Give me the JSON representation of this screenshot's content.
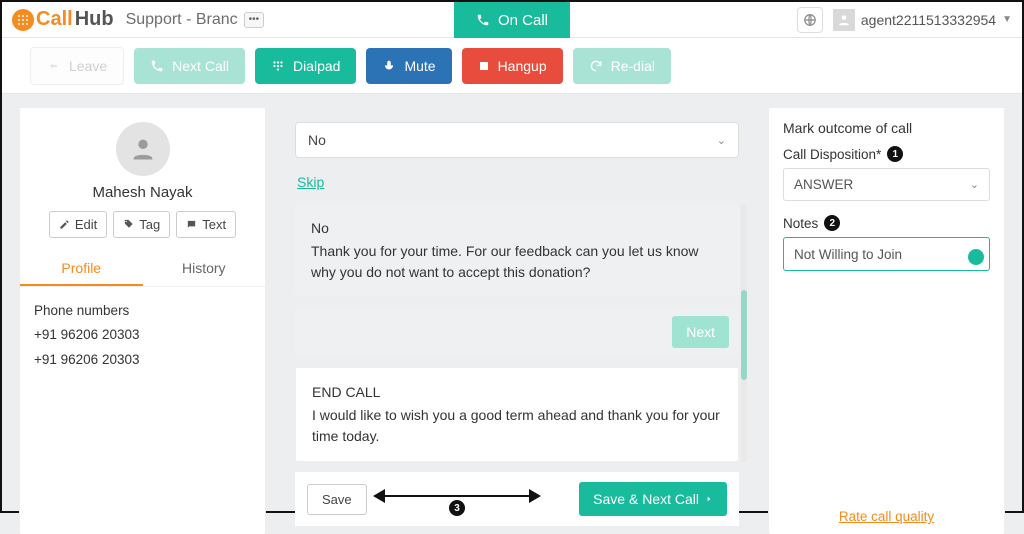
{
  "header": {
    "logo_call": "Call",
    "logo_hub": "Hub",
    "page_title": "Support - Branc",
    "on_call": "On Call",
    "agent_name": "agent2211513332954"
  },
  "toolbar": {
    "leave": "Leave",
    "next_call": "Next Call",
    "dialpad": "Dialpad",
    "mute": "Mute",
    "hangup": "Hangup",
    "redial": "Re-dial"
  },
  "contact": {
    "name": "Mahesh Nayak",
    "edit": "Edit",
    "tag": "Tag",
    "text": "Text",
    "tab_profile": "Profile",
    "tab_history": "History",
    "phone_label": "Phone numbers",
    "phone1": "+91 96206 20303",
    "phone2": "+91 96206 20303"
  },
  "script": {
    "answer_value": "No",
    "skip": "Skip",
    "block1_title": "No",
    "block1_body": "Thank you for your time.  For our feedback can you let us know why you do not want to accept this donation?",
    "next": "Next",
    "block2_title": "END CALL",
    "block2_body": "I would like to wish you a good term ahead and thank you for your time today.",
    "save": "Save",
    "save_next": "Save & Next Call"
  },
  "outcome": {
    "heading": "Mark outcome of call",
    "disposition_label": "Call Disposition*",
    "disposition_value": "ANSWER",
    "notes_label": "Notes",
    "notes_value": "Not Willing to Join",
    "rate_link": "Rate call quality"
  },
  "annotations": {
    "b1": "1",
    "b2": "2",
    "b3": "3"
  }
}
